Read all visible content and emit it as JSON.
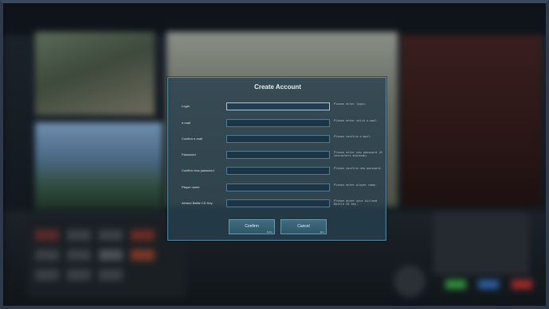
{
  "dialog": {
    "title": "Create Account",
    "fields": [
      {
        "label": "Login",
        "value": "",
        "hint": "Please enter login."
      },
      {
        "label": "e-mail",
        "value": "",
        "hint": "Please enter valid e-mail."
      },
      {
        "label": "Confirm e-mail",
        "value": "",
        "hint": "Please confirm e-mail."
      },
      {
        "label": "Password",
        "value": "",
        "hint": "Please enter new password (6 characters minimum)."
      },
      {
        "label": "Confirm new password",
        "value": "",
        "hint": "Please confirm new password."
      },
      {
        "label": "Player name",
        "value": "",
        "hint": "Please enter player name."
      },
      {
        "label": "Airland Battle CD Key",
        "value": "",
        "hint": "Please enter your Airland Battle CD key."
      }
    ],
    "confirm_label": "Confirm",
    "confirm_hotkey": "Enter",
    "cancel_label": "Cancel",
    "cancel_hotkey": "Esc"
  },
  "colors": {
    "dialog_bg": "#284050",
    "dialog_border": "#5e8aa0",
    "button_bg": "#3f6c80"
  }
}
